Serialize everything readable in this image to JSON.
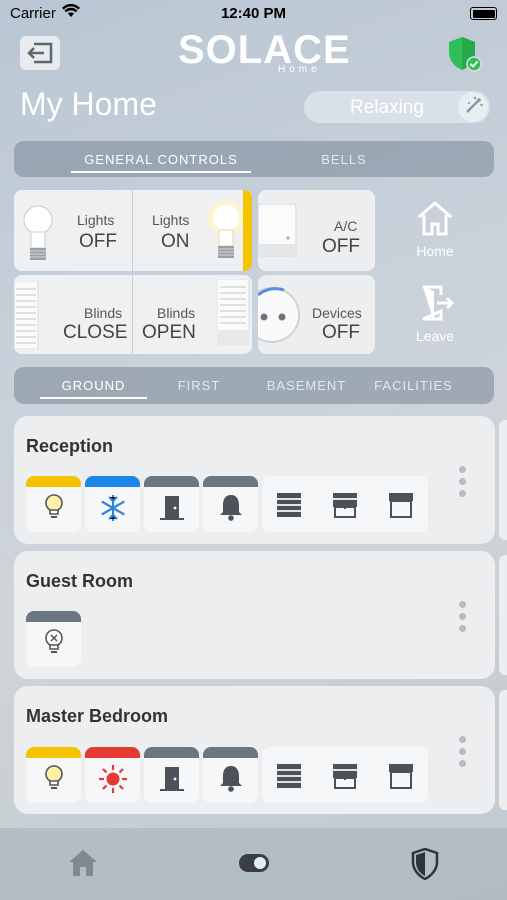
{
  "status": {
    "carrier": "Carrier",
    "time": "12:40 PM"
  },
  "header": {
    "logo_main": "SOLACE",
    "logo_sub": "Home",
    "title": "My Home",
    "mode_label": "Relaxing"
  },
  "top_tabs": [
    {
      "label": "GENERAL CONTROLS",
      "active": true
    },
    {
      "label": "BELLS",
      "active": false
    }
  ],
  "general_controls": {
    "lights_off": {
      "l1": "Lights",
      "l2": "OFF"
    },
    "lights_on": {
      "l1": "Lights",
      "l2": "ON"
    },
    "ac": {
      "l1": "A/C",
      "l2": "OFF"
    },
    "blinds_close": {
      "l1": "Blinds",
      "l2": "CLOSE"
    },
    "blinds_open": {
      "l1": "Blinds",
      "l2": "OPEN"
    },
    "devices": {
      "l1": "Devices",
      "l2": "OFF"
    }
  },
  "side_actions": {
    "home": "Home",
    "leave": "Leave"
  },
  "floor_tabs": [
    {
      "label": "GROUND",
      "active": true
    },
    {
      "label": "FIRST",
      "active": false
    },
    {
      "label": "BASEMENT",
      "active": false
    },
    {
      "label": "FACILITIES",
      "active": false
    }
  ],
  "rooms": [
    {
      "name": "Reception"
    },
    {
      "name": "Guest Room"
    },
    {
      "name": "Master Bedroom"
    }
  ],
  "colors": {
    "light_on": "#f4c400",
    "ac_cool": "#1a86e6",
    "ac_heat": "#e53935",
    "tile_idle": "#6b7681",
    "shield_green": "#2fbf59"
  },
  "icons": [
    "back-arrow-icon",
    "shield-check-icon",
    "mode-icon",
    "bulb-icon",
    "snowflake-icon",
    "sun-icon",
    "door-icon",
    "bell-icon",
    "blinds-closed-icon",
    "blinds-half-icon",
    "blinds-open-icon",
    "home-icon",
    "leave-door-icon",
    "toggle-icon",
    "shield-icon"
  ]
}
